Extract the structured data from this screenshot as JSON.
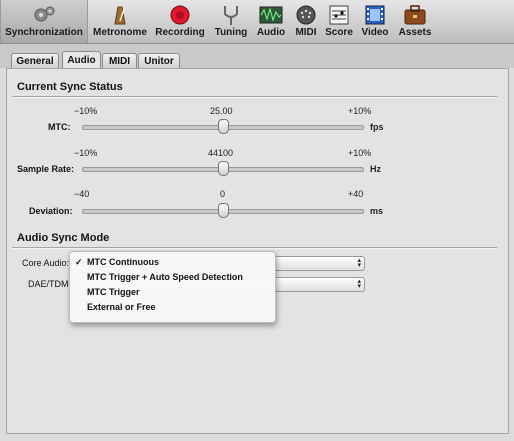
{
  "toolbar": {
    "items": [
      {
        "label": "Synchronization",
        "icon": "gears-icon"
      },
      {
        "label": "Metronome",
        "icon": "metronome-icon"
      },
      {
        "label": "Recording",
        "icon": "record-icon"
      },
      {
        "label": "Tuning",
        "icon": "tuning-fork-icon"
      },
      {
        "label": "Audio",
        "icon": "audio-waveform-icon"
      },
      {
        "label": "MIDI",
        "icon": "midi-port-icon"
      },
      {
        "label": "Score",
        "icon": "score-icon"
      },
      {
        "label": "Video",
        "icon": "film-icon"
      },
      {
        "label": "Assets",
        "icon": "briefcase-icon"
      }
    ],
    "selected": "Synchronization"
  },
  "tabs": [
    {
      "label": "General"
    },
    {
      "label": "Audio",
      "active": true
    },
    {
      "label": "MIDI"
    },
    {
      "label": "Unitor"
    }
  ],
  "sync_status": {
    "title": "Current Sync Status",
    "rows": [
      {
        "label": "MTC:",
        "min": "−10%",
        "center": "25.00",
        "max": "+10%",
        "unit": "fps",
        "value_fraction": 0.5
      },
      {
        "label": "Sample Rate:",
        "min": "−10%",
        "center": "44100",
        "max": "+10%",
        "unit": "Hz",
        "value_fraction": 0.5
      },
      {
        "label": "Deviation:",
        "min": "−40",
        "center": "0",
        "max": "+40",
        "unit": "ms",
        "value_fraction": 0.5
      }
    ]
  },
  "audio_sync": {
    "title": "Audio Sync Mode",
    "core_audio_label": "Core Audio:",
    "dae_label": "DAE/TDM:",
    "dae_value": ""
  },
  "menu": {
    "items": [
      {
        "label": "MTC Continuous",
        "checked": true,
        "check": "✓"
      },
      {
        "label": "MTC Trigger + Auto Speed Detection",
        "checked": false
      },
      {
        "label": "MTC Trigger",
        "checked": false
      },
      {
        "label": "External or Free",
        "checked": false
      }
    ]
  },
  "colors": {
    "record_red": "#e0182f",
    "panel_bg": "#e3e3e3",
    "toolbar_bg": "#c8c8c8"
  }
}
